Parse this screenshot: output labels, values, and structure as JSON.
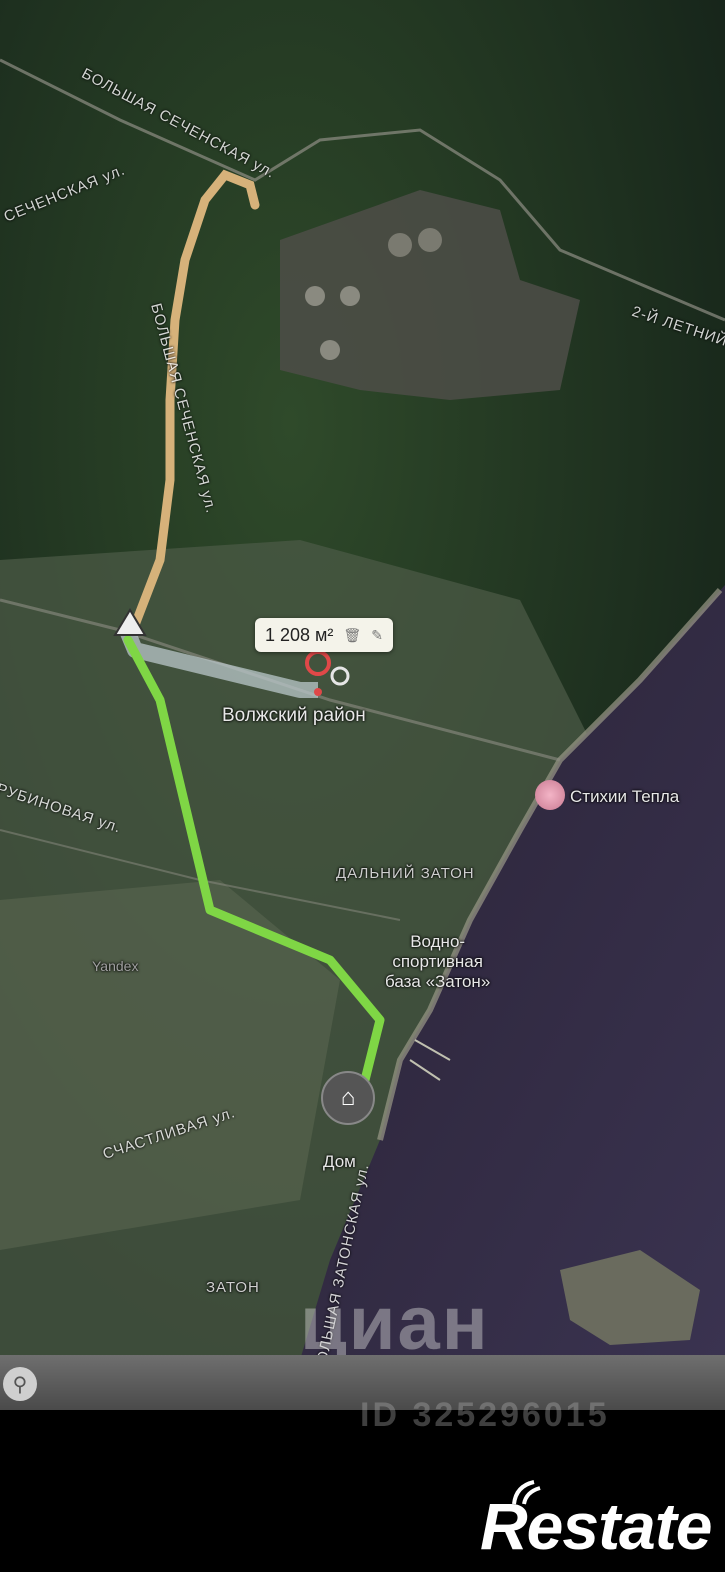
{
  "map": {
    "area_value": "1 208 м²",
    "area_delete_icon": "trash-icon",
    "area_edit_icon": "pencil-icon",
    "district_label": "Волжский район",
    "poi_stikhii": "Стихии Тепла",
    "locality_dalniy": "ДАЛЬНИЙ ЗАТОН",
    "water_base_line1": "Водно-",
    "water_base_line2": "спортивная",
    "water_base_line3": "база «Затон»",
    "home_label": "Дом",
    "zaton_label": "ЗАТОН",
    "yandex_label": "Yandex",
    "roads": {
      "bolshaya_top": "БОЛЬШАЯ СЕЧЕНСКАЯ ул.",
      "sechenskaya_left": "СЕЧЕНСКАЯ ул.",
      "bolshaya_vertical": "БОЛЬШАЯ СЕЧЕНСКАЯ ул.",
      "letniy": "2-Й ЛЕТНИЙ",
      "rubinovaya": "РУБИНОВАЯ ул.",
      "schastlivaya": "СЧАСТЛИВАЯ ул.",
      "zatonskaya": "БОЛЬШАЯ ЗАТОНСКАЯ ул."
    },
    "route_color": "#7fd645",
    "alt_route_color": "#b9c7c9",
    "highway_color": "#d6b27a"
  },
  "watermark": {
    "cian": "циан",
    "cian_id": "ID 325296015"
  },
  "logo": {
    "restate": "Restate"
  }
}
